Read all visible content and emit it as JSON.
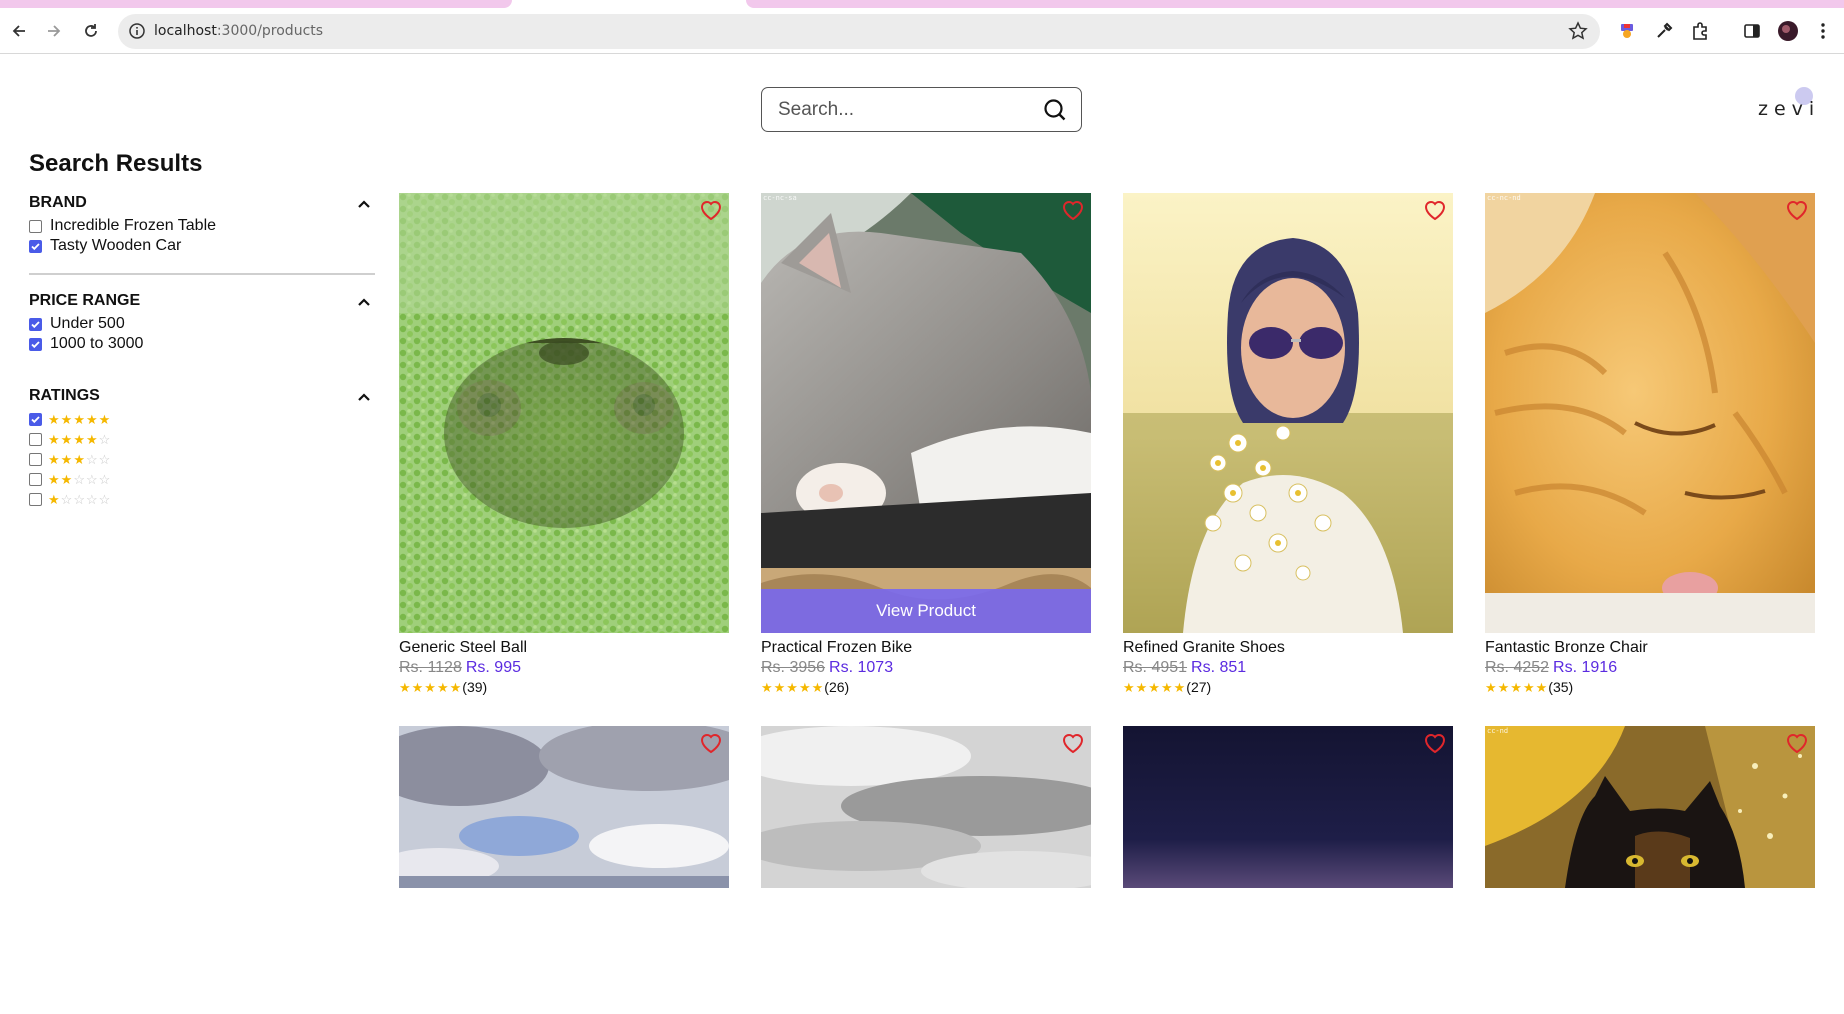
{
  "browser": {
    "url_host": "localhost",
    "url_path": ":3000/products"
  },
  "header": {
    "search_placeholder": "Search...",
    "logo": "zevi"
  },
  "sidebar": {
    "title": "Search Results",
    "brand": {
      "label": "BRAND",
      "options": [
        {
          "label": "Incredible Frozen Table",
          "checked": false
        },
        {
          "label": "Tasty Wooden Car",
          "checked": true
        }
      ]
    },
    "price": {
      "label": "PRICE RANGE",
      "options": [
        {
          "label": "Under 500",
          "checked": true
        },
        {
          "label": "1000 to 3000",
          "checked": true
        }
      ]
    },
    "ratings": {
      "label": "RATINGS",
      "options": [
        {
          "stars": 5,
          "checked": true
        },
        {
          "stars": 4,
          "checked": false
        },
        {
          "stars": 3,
          "checked": false
        },
        {
          "stars": 2,
          "checked": false
        },
        {
          "stars": 1,
          "checked": false
        }
      ]
    }
  },
  "products": [
    {
      "name": "Generic Steel Ball",
      "old_price": "Rs. 1128",
      "new_price": "Rs. 995",
      "reviews": "(39)",
      "stars": 5
    },
    {
      "name": "Practical Frozen Bike",
      "old_price": "Rs. 3956",
      "new_price": "Rs. 1073",
      "reviews": "(26)",
      "stars": 5,
      "hover_label": "View Product",
      "watermark": "cc-nc-sa"
    },
    {
      "name": "Refined Granite Shoes",
      "old_price": "Rs. 4951",
      "new_price": "Rs. 851",
      "reviews": "(27)",
      "stars": 5
    },
    {
      "name": "Fantastic Bronze Chair",
      "old_price": "Rs. 4252",
      "new_price": "Rs. 1916",
      "reviews": "(35)",
      "stars": 5,
      "watermark": "cc-nc-nd"
    }
  ],
  "second_row_watermark": "cc-nd",
  "colors": {
    "accent_price": "#5b2be0",
    "checkbox": "#4a5be8",
    "star": "#f5b800",
    "heart": "#e0262b",
    "view_overlay": "#7868f0"
  }
}
